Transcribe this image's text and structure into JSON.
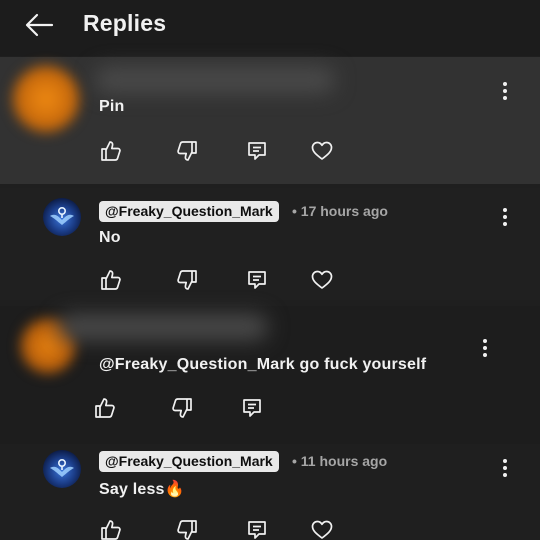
{
  "header": {
    "title": "Replies",
    "back_icon": "arrow-left-icon"
  },
  "comments": [
    {
      "author": "",
      "time": "",
      "text": "Pin",
      "highlighted": true,
      "avatar": "blurred-orange",
      "actions": [
        "thumbs-up-icon",
        "thumbs-down-icon",
        "reply-icon",
        "heart-icon"
      ]
    },
    {
      "author": "@Freaky_Question_Mark",
      "time": "• 17 hours ago",
      "text": "No",
      "avatar": "blue-emblem",
      "actions": [
        "thumbs-up-icon",
        "thumbs-down-icon",
        "reply-icon",
        "heart-icon"
      ]
    },
    {
      "author": "",
      "time": "",
      "text": "@Freaky_Question_Mark go fuck yourself",
      "avatar": "blurred-orange",
      "actions": [
        "thumbs-up-icon",
        "thumbs-down-icon",
        "reply-icon"
      ]
    },
    {
      "author": "@Freaky_Question_Mark",
      "time": "• 11 hours ago",
      "text": "Say less🔥",
      "avatar": "blue-emblem",
      "actions": [
        "thumbs-up-icon",
        "thumbs-down-icon",
        "reply-icon",
        "heart-icon"
      ]
    }
  ],
  "colors": {
    "background": "#1f1f1f",
    "highlight": "#323232",
    "handle_chip": "#e9e9e9",
    "avatar_orange": "#e07b10",
    "avatar_blue": "#2f66c9"
  }
}
